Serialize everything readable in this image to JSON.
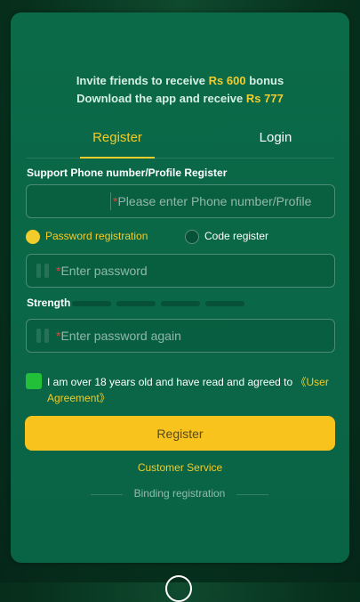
{
  "promo": {
    "line1_prefix": "Invite friends to receive ",
    "line1_amount": "Rs 600",
    "line1_suffix": " bonus",
    "line2_prefix": "Download the app and receive ",
    "line2_amount": "Rs 777"
  },
  "tabs": {
    "register": "Register",
    "login": "Login"
  },
  "form": {
    "section_label": "Support Phone number/Profile Register",
    "phone_placeholder": "Please enter Phone number/Profile",
    "required_mark": "*",
    "radio_password": "Password registration",
    "radio_code": "Code register",
    "password_placeholder": "Enter password",
    "strength_label": "Strength",
    "password_again_placeholder": "Enter password again",
    "agree_text": "I am over 18 years old and have read and agreed to ",
    "agree_link": "《User Agreement》",
    "register_button": "Register",
    "customer_service": "Customer Service",
    "binding_registration": "Binding registration"
  },
  "colors": {
    "accent": "#f2cc2a",
    "panel": "#0b6a48",
    "checkbox": "#22c039",
    "button": "#f7c31c"
  }
}
